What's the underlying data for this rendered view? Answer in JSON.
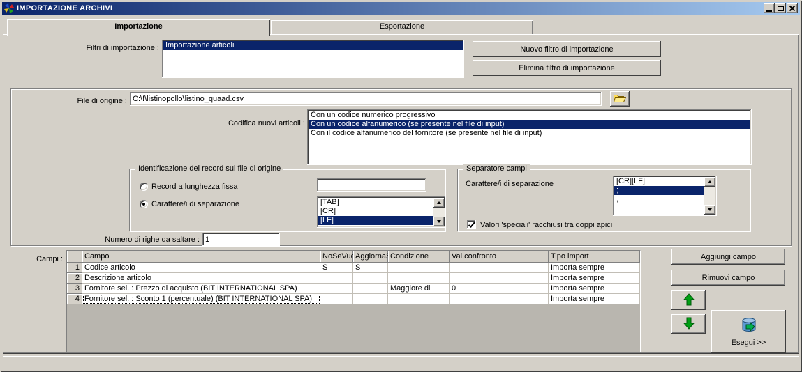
{
  "window": {
    "title": "IMPORTAZIONE ARCHIVI"
  },
  "tabs": {
    "importazione": "Importazione",
    "esportazione": "Esportazione"
  },
  "filters": {
    "label": "Filtri di importazione :",
    "items": [
      "Importazione articoli"
    ],
    "selected_index": 0,
    "new_button": "Nuovo filtro di importazione",
    "delete_button": "Elimina filtro di importazione"
  },
  "source_file": {
    "label": "File di origine :",
    "value": "C:\\!\\listinopollo\\listino_quaad.csv"
  },
  "encoding": {
    "label": "Codifica nuovi articoli :",
    "options": [
      "Con un codice numerico progressivo",
      "Con un codice alfanumerico (se presente nel file di input)",
      "Con il codice alfanumerico del fornitore (se presente nel file di input)"
    ],
    "selected_index": 1
  },
  "record_identification": {
    "title": "Identificazione dei record sul file di origine",
    "fixed_length_label": "Record a lunghezza fissa",
    "fixed_length_value": "",
    "separator_label": "Carattere/i di separazione",
    "separator_options": [
      "[TAB]",
      "[CR]",
      "[LF]"
    ],
    "selected_index": 2
  },
  "field_separator": {
    "title": "Separatore campi",
    "label": "Carattere/i di separazione",
    "options": [
      "[CR][LF]",
      ";",
      ","
    ],
    "selected_index": 1,
    "quotes_checkbox_label": "Valori 'speciali' racchiusi tra doppi apici",
    "quotes_checked": true
  },
  "skip_rows": {
    "label": "Numero di righe da saltare :",
    "value": "1"
  },
  "fields_table": {
    "label": "Campi :",
    "columns": {
      "num": "",
      "campo": "Campo",
      "nosevuo": "NoSeVuo",
      "aggiorna": "AggiornaS",
      "condizione": "Condizione",
      "confronto": "Val.confronto",
      "tipo": "Tipo import"
    },
    "rows": [
      {
        "num": "1",
        "campo": "Codice articolo",
        "nosevuo": "S",
        "aggiorna": "S",
        "condizione": "",
        "confronto": "",
        "tipo": "Importa sempre"
      },
      {
        "num": "2",
        "campo": "Descrizione articolo",
        "nosevuo": "",
        "aggiorna": "",
        "condizione": "",
        "confronto": "",
        "tipo": "Importa sempre"
      },
      {
        "num": "3",
        "campo": "Fornitore sel. : Prezzo di acquisto (BIT INTERNATIONAL SPA)",
        "nosevuo": "",
        "aggiorna": "",
        "condizione": "Maggiore di",
        "confronto": "0",
        "tipo": "Importa sempre"
      },
      {
        "num": "4",
        "campo": "Fornitore sel. : Sconto 1 (percentuale) (BIT INTERNATIONAL SPA)",
        "nosevuo": "",
        "aggiorna": "",
        "condizione": "",
        "confronto": "",
        "tipo": "Importa sempre"
      }
    ]
  },
  "actions": {
    "add_field": "Aggiungi campo",
    "remove_field": "Rimuovi campo",
    "execute": "Esegui >>"
  },
  "icons": {
    "app_icon": "multicolor-pinwheel",
    "browse_button": "open-folder",
    "move_up_button": "green-arrow-up",
    "move_down_button": "green-arrow-down",
    "execute_button": "database-with-green-arrow"
  },
  "colors": {
    "selection_bg": "#0A246A",
    "titlebar_start": "#0A246A",
    "titlebar_end": "#A6CAF0",
    "window_bg": "#D4D0C8"
  }
}
